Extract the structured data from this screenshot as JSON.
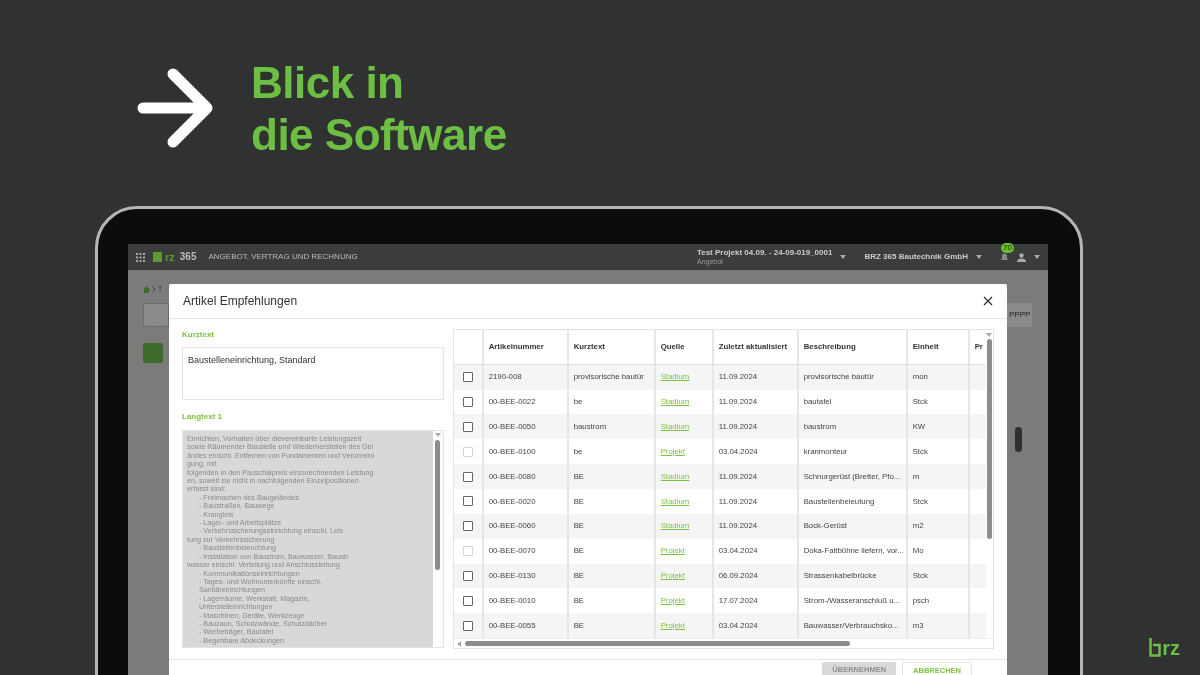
{
  "headline": {
    "lines": [
      "Blick in",
      "die Software"
    ]
  },
  "topbar": {
    "logo_text": "rz",
    "logo_suffix": "365",
    "product": "ANGEBOT, VERTRAG UND RECHNUNG",
    "project": "Test Projekt 04.09. - 24-09-019_0001",
    "project_subtitle": "Angebot",
    "company": "BRZ 365 Bautechnik GmbH",
    "notification_count": "70"
  },
  "background": {
    "breadcrumb": "T",
    "button": "PPPP"
  },
  "dialog": {
    "title": "Artikel Empfehlungen",
    "kurztext_label": "Kurztext",
    "kurztext_value": "Baustelleneinrichtung, Standard",
    "langtext_label": "Langtext 1",
    "langtext_value": "Einrichten, Vorhalten über dievereinbarte Leistungszeit\nsowie Räumender Baustelle und Wiederherstellen des Gel\nändes einschl. Entfernen von Fundamenten und Verunreini\ngung, mit\nfolgenden in den Pauschalpreis einzurechnenden Leistung\nen, soweit sie nicht in nachfolgenden Einzelpositionen\nerfasst sind:\n\t- Freimachen des Baugeländes\n\t- Baustraßen, Bauwege\n\t- Krangleis\n\t- Lager- und Arbeitsplätze\n\t- Verkehrssicherungseinrichtung einschl. Leis\ntung zur Verkehrssicherung\n\t- Baustellenbeleuchtung\n\t- Installation von Baustrom, Bauwasser, Bauab\nwasser einschl. Verteilung und Anschlussleitung\n\t- Kommunikationseinrichtungen\n\t- Tages- und Wohnunterkünfte einschl.\n\tSanitäreinrichtungen\n\t- Lagerräume, Werkstatt, Magazin,\n\tUnterstelleinrichtungen\n\t- Maschinen, Geräte, Werkzeuge\n\t- Bauzaun, Schutzwände, Schutzdächer\n\t- Werbeträger, Bautafel\n\t- Begehbare Abdeckungen",
    "table": {
      "columns": [
        "Artikelnummer",
        "Kurztext",
        "Quelle",
        "Zuletzt aktualisiert",
        "Beschreibung",
        "Einheit",
        "Pr"
      ],
      "rows": [
        {
          "checked": false,
          "disabled": false,
          "cells": [
            "2190-008",
            "provisorische bautür",
            "Stadium",
            "11.09.2024",
            "provisorische bautür",
            "mon"
          ]
        },
        {
          "checked": false,
          "disabled": false,
          "cells": [
            "00-BEE-0022",
            "be",
            "Stadium",
            "11.09.2024",
            "bautafel",
            "Stck"
          ]
        },
        {
          "checked": false,
          "disabled": false,
          "cells": [
            "00-BEE-0050",
            "baustrom",
            "Stadium",
            "11.09.2024",
            "baustrom",
            "KW"
          ]
        },
        {
          "checked": false,
          "disabled": true,
          "cells": [
            "00-BEE-0100",
            "be",
            "Projekt",
            "03.04.2024",
            "kranmonteur",
            "Stck"
          ]
        },
        {
          "checked": false,
          "disabled": false,
          "cells": [
            "00-BEE-0080",
            "BE",
            "Stadium",
            "11.09.2024",
            "Schnurgerüst (Bretter, Pfo...",
            "m"
          ]
        },
        {
          "checked": false,
          "disabled": false,
          "cells": [
            "00-BEE-0020",
            "BE",
            "Stadium",
            "11.09.2024",
            "Baustellenbeleutung",
            "Stck"
          ]
        },
        {
          "checked": false,
          "disabled": false,
          "cells": [
            "00-BEE-0060",
            "BE",
            "Stadium",
            "11.09.2024",
            "Bock-Gerüst",
            "m2"
          ]
        },
        {
          "checked": false,
          "disabled": true,
          "cells": [
            "00-BEE-0070",
            "BE",
            "Projekt",
            "03.04.2024",
            "Doka-Faltbühne liefern, vor...",
            "Mo"
          ]
        },
        {
          "checked": false,
          "disabled": false,
          "cells": [
            "00-BEE-0130",
            "BE",
            "Projekt",
            "06.09.2024",
            "Strassenkabelbrücke",
            "Stck"
          ]
        },
        {
          "checked": false,
          "disabled": false,
          "cells": [
            "00-BEE-0010",
            "BE",
            "Projekt",
            "17.07.2024",
            "Strom-/Wasseranschluß u...",
            "psch"
          ]
        },
        {
          "checked": false,
          "disabled": false,
          "cells": [
            "00-BEE-0055",
            "BE",
            "Projekt",
            "03.04.2024",
            "Bauwasser/Verbrauchsko...",
            "m3"
          ]
        }
      ]
    },
    "buttons": [
      {
        "label": "ÜBERNEHMEN",
        "disabled": true
      },
      {
        "label": "ABBRECHEN",
        "disabled": false
      }
    ]
  },
  "corner_logo": "rz"
}
